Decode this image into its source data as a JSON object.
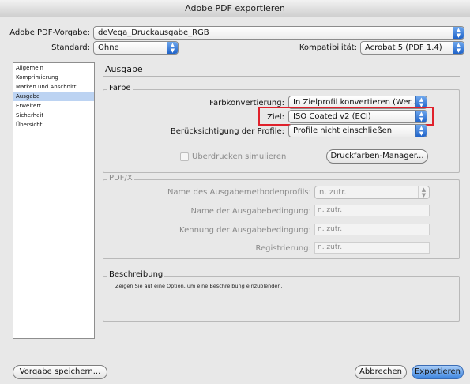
{
  "window": {
    "title": "Adobe PDF exportieren"
  },
  "top": {
    "preset_label": "Adobe PDF-Vorgabe:",
    "preset_value": "deVega_Druckausgabe_RGB",
    "standard_label": "Standard:",
    "standard_value": "Ohne",
    "compat_label": "Kompatibilität:",
    "compat_value": "Acrobat 5 (PDF 1.4)"
  },
  "sidebar": {
    "items": [
      {
        "label": "Allgemein"
      },
      {
        "label": "Komprimierung"
      },
      {
        "label": "Marken und Anschnitt"
      },
      {
        "label": "Ausgabe"
      },
      {
        "label": "Erweitert"
      },
      {
        "label": "Sicherheit"
      },
      {
        "label": "Übersicht"
      }
    ],
    "selected": "Ausgabe"
  },
  "panel": {
    "title": "Ausgabe"
  },
  "farbe": {
    "legend": "Farbe",
    "conversion_label": "Farbkonvertierung:",
    "conversion_value": "In Zielprofil konvertieren (Wer...",
    "ziel_label": "Ziel:",
    "ziel_value": "ISO Coated v2 (ECI)",
    "profiles_label": "Berücksichtigung der Profile:",
    "profiles_value": "Profile nicht einschließen",
    "overprint_label": "Überdrucken simulieren",
    "ink_manager_label": "Druckfarben-Manager..."
  },
  "pdfx": {
    "legend": "PDF/X",
    "output_profile_label": "Name des Ausgabemethodenprofils:",
    "output_profile_value": "n. zutr.",
    "condition_name_label": "Name der Ausgabebedingung:",
    "condition_name_value": "n. zutr.",
    "condition_id_label": "Kennung der Ausgabebedingung:",
    "condition_id_value": "n. zutr.",
    "registry_label": "Registrierung:",
    "registry_value": "n. zutr."
  },
  "description": {
    "legend": "Beschreibung",
    "text": "Zeigen Sie auf eine Option, um eine Beschreibung einzublenden."
  },
  "footer": {
    "save_preset_label": "Vorgabe speichern...",
    "cancel_label": "Abbrechen",
    "export_label": "Exportieren"
  },
  "colors": {
    "highlight": "#e0212b",
    "accent": "#3d86e0"
  }
}
